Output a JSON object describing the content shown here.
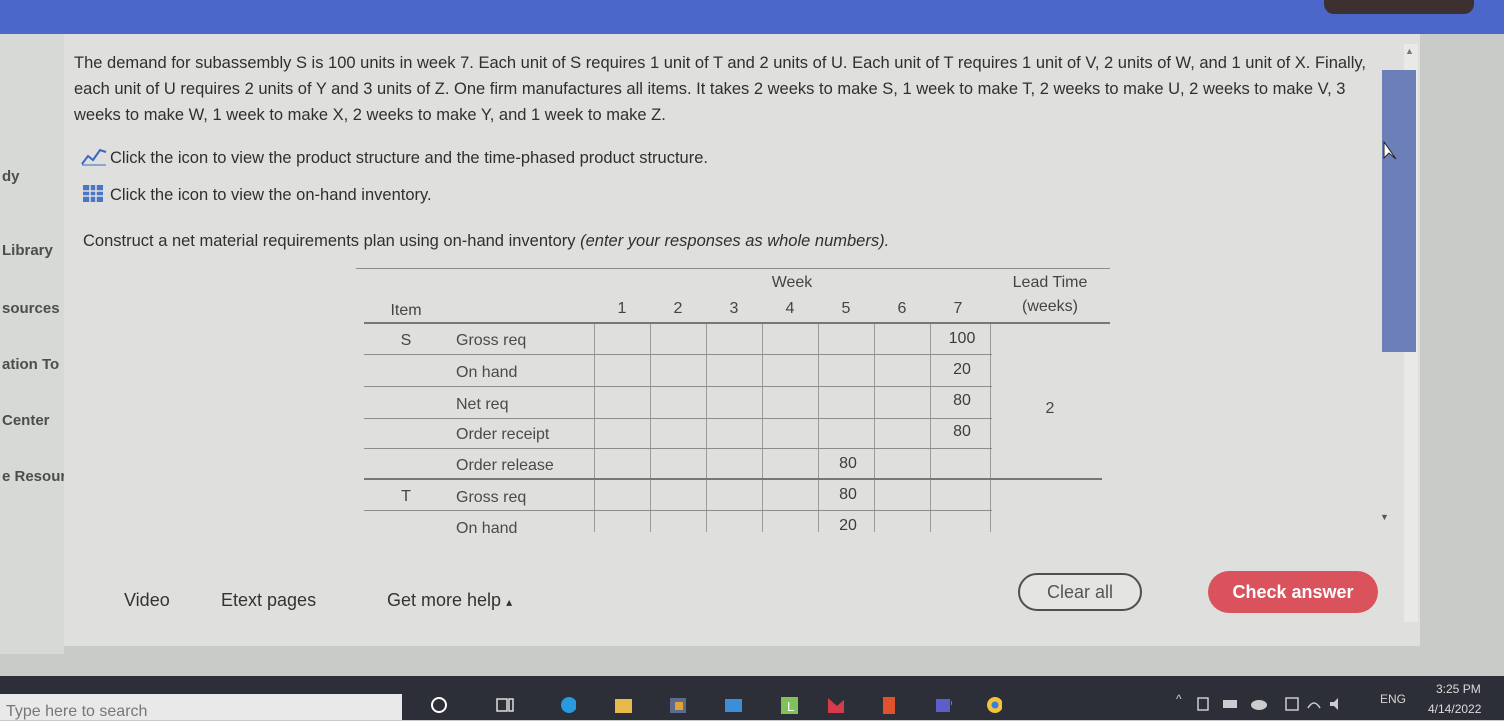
{
  "left_nav": [
    "dy",
    "Library",
    "sources",
    "ation To",
    "Center",
    "e Resourc"
  ],
  "problem_text": "The demand for subassembly S is 100 units in week 7. Each unit of S requires 1 unit of T and 2 units of U. Each unit of T requires 1 unit of V, 2 units of W, and 1 unit of X. Finally, each unit of U requires 2 units of Y and 3 units of Z. One firm manufactures all items. It takes 2 weeks to make S, 1 week to make T, 2 weeks to make U, 2 weeks to make V, 3 weeks to make W, 1 week to make X, 2 weeks to make Y, and 1 week to make Z.",
  "help_links": {
    "structure": "Click the icon to view the product structure and the time-phased product structure.",
    "inventory": "Click the icon to view the on-hand inventory."
  },
  "instruction": "Construct a net material requirements plan using on-hand inventory",
  "instruction_italic": "(enter your responses as whole numbers).",
  "table": {
    "week_header": "Week",
    "item_header": "Item",
    "lead_header_1": "Lead Time",
    "lead_header_2": "(weeks)",
    "weeks": [
      "1",
      "2",
      "3",
      "4",
      "5",
      "6",
      "7"
    ],
    "items": [
      {
        "item": "S",
        "lead_time": "2",
        "rows": [
          {
            "label": "Gross req",
            "values": [
              "",
              "",
              "",
              "",
              "",
              "",
              "100"
            ]
          },
          {
            "label": "On hand",
            "values": [
              "",
              "",
              "",
              "",
              "",
              "",
              "20"
            ]
          },
          {
            "label": "Net req",
            "values": [
              "",
              "",
              "",
              "",
              "",
              "",
              "80"
            ]
          },
          {
            "label": "Order receipt",
            "values": [
              "",
              "",
              "",
              "",
              "",
              "",
              "80"
            ]
          },
          {
            "label": "Order release",
            "values": [
              "",
              "",
              "",
              "",
              "80",
              "",
              ""
            ]
          }
        ]
      },
      {
        "item": "T",
        "lead_time": "",
        "rows": [
          {
            "label": "Gross req",
            "values": [
              "",
              "",
              "",
              "",
              "80",
              "",
              ""
            ]
          },
          {
            "label": "On hand",
            "values": [
              "",
              "",
              "",
              "",
              "20",
              "",
              ""
            ]
          }
        ]
      }
    ]
  },
  "footer": {
    "video": "Video",
    "etext": "Etext pages",
    "help": "Get more help",
    "help_caret": "▴",
    "clear_all": "Clear all",
    "check_answer": "Check answer"
  },
  "taskbar": {
    "search_placeholder": "Type here to search",
    "lang": "ENG",
    "time": "3:25 PM",
    "date": "4/14/2022"
  },
  "colors": {
    "accent_blue": "#4a67c9",
    "check_button": "#d9525c"
  }
}
